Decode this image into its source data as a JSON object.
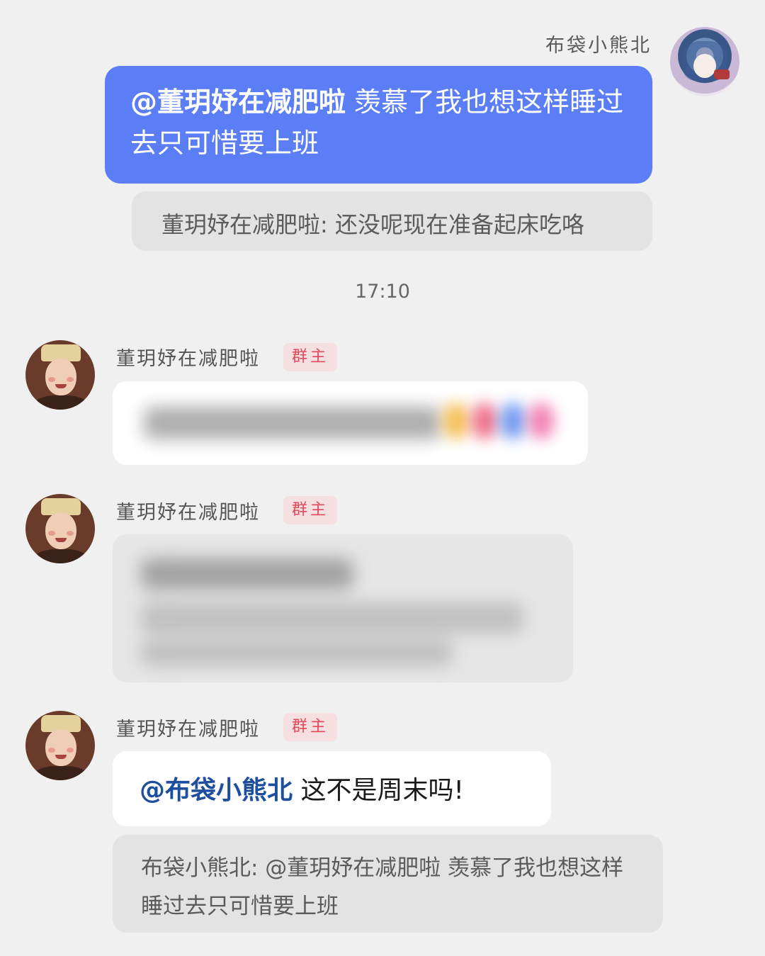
{
  "self_message": {
    "sender": "布袋小熊北",
    "mention": "@董玥妤在减肥啦",
    "text": " 羡慕了我也想这样睡过去只可惜要上班",
    "reply_quote": "董玥妤在减肥啦: 还没呢现在准备起床吃咯"
  },
  "timestamp": "17:10",
  "messages": [
    {
      "sender": "董玥妤在减肥啦",
      "badge": "群主"
    },
    {
      "sender": "董玥妤在减肥啦",
      "badge": "群主"
    },
    {
      "sender": "董玥妤在减肥啦",
      "badge": "群主",
      "mention": "@布袋小熊北",
      "text": " 这不是周末吗!",
      "reply_quote": "布袋小熊北: @董玥妤在减肥啦 羡慕了我也想这样睡过去只可惜要上班"
    }
  ],
  "colors": {
    "background": "#f0f0f0",
    "self_bubble": "#5b7df5",
    "quote_bubble": "#e3e3e3",
    "mention_blue": "#1e4f9e",
    "badge_text": "#e24a5a",
    "badge_bg": "#f6dfe1"
  }
}
